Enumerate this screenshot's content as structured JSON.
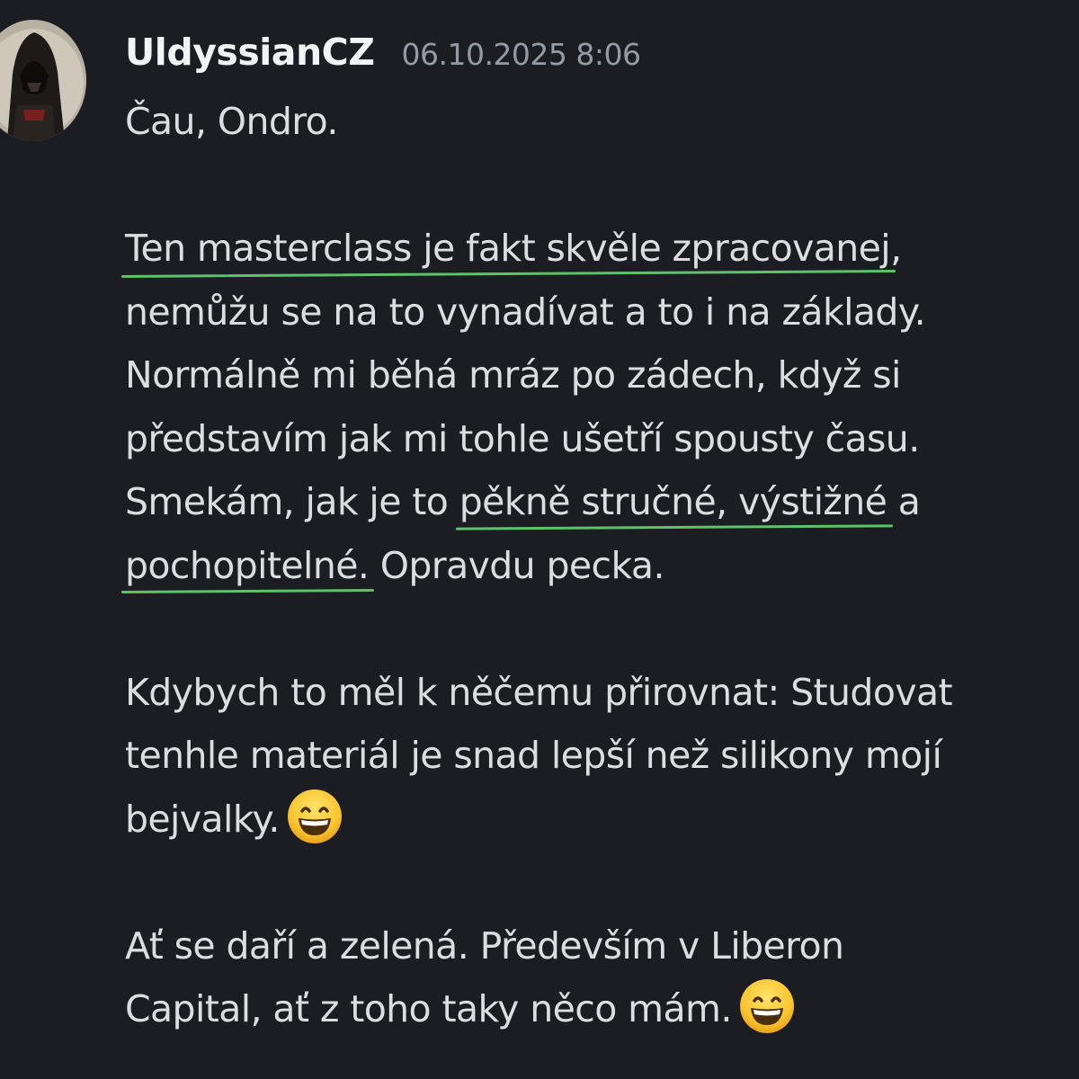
{
  "message": {
    "username": "UldyssianCZ",
    "timestamp": "06.10.2025 8:06",
    "avatar_icon": "hooded-assassin-avatar",
    "highlight_color": "#5ec26a",
    "lines": {
      "greeting": "Čau, Ondro.",
      "p2_l1_hl": "Ten masterclass je fakt skvěle zpracovanej",
      "p2_l1_rest": ",",
      "p2_l2": "nemůžu se na to vynadívat a to i na základy.",
      "p2_l3": "Normálně mi běhá mráz po zádech, když si",
      "p2_l4": "představím jak mi tohle ušetří spousty času.",
      "p2_l5_a": "Smekám, jak je to ",
      "p2_l5_hl": "pěkně stručné, výstižné",
      "p2_l5_b": " a",
      "p2_l6_hl": "pochopitelné.",
      "p2_l6_rest": " Opravdu pecka.",
      "p3_l1": "Kdybych to měl k něčemu přirovnat: Studovat",
      "p3_l2": "tenhle materiál je snad lepší než silikony mojí",
      "p3_l3": "bejvalky.",
      "p4_l1": "Ať se daří a zelená. Především v Liberon",
      "p4_l2": "Capital, ať z toho taky něco mám."
    },
    "emoji_icon": "grinning-face-emoji"
  }
}
